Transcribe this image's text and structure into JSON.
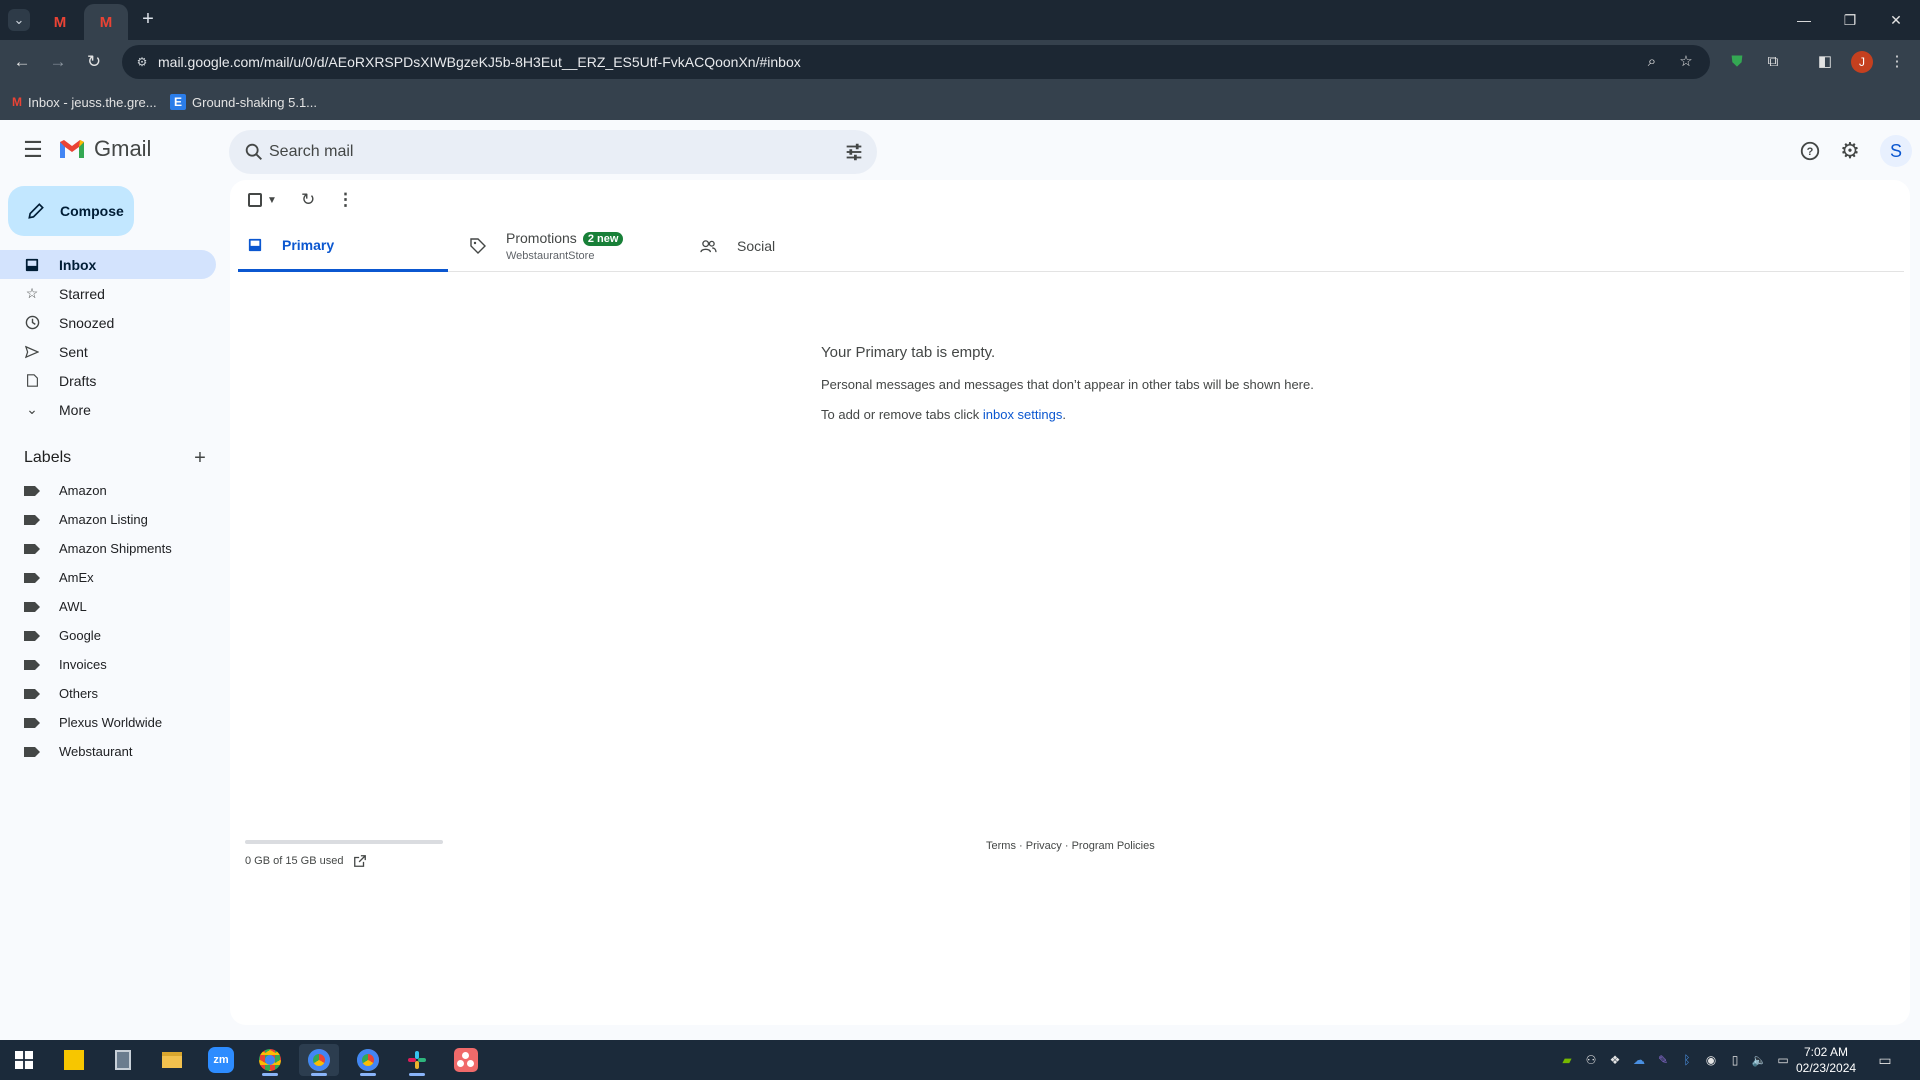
{
  "browser": {
    "tabs": [
      {
        "title": "Inbox - jeuss.the.gre...",
        "active": false
      },
      {
        "title": "Inbox - jeuss.the.gre...",
        "active": true
      }
    ],
    "url": "mail.google.com/mail/u/0/d/AEoRXRSPDsXIWBgzeKJ5b-8H3Eut__ERZ_ES5Utf-FvkACQoonXn/#inbox",
    "profile_initial": "J",
    "bookmarks": [
      {
        "label": "Inbox - jeuss.the.gre...",
        "icon": "gmail-icon"
      },
      {
        "label": "Ground-shaking 5.1...",
        "icon": "e-site-icon"
      }
    ]
  },
  "gmail": {
    "brand": "Gmail",
    "search_placeholder": "Search mail",
    "avatar_initial": "S",
    "compose_label": "Compose",
    "nav": [
      {
        "label": "Inbox",
        "icon": "inbox-icon",
        "active": true
      },
      {
        "label": "Starred",
        "icon": "star-icon",
        "active": false
      },
      {
        "label": "Snoozed",
        "icon": "clock-icon",
        "active": false
      },
      {
        "label": "Sent",
        "icon": "send-icon",
        "active": false
      },
      {
        "label": "Drafts",
        "icon": "draft-icon",
        "active": false
      },
      {
        "label": "More",
        "icon": "chevron-down-icon",
        "active": false
      }
    ],
    "labels_title": "Labels",
    "labels": [
      "Amazon",
      "Amazon Listing",
      "Amazon Shipments",
      "AmEx",
      "AWL",
      "Google",
      "Invoices",
      "Others",
      "Plexus Worldwide",
      "Webstaurant"
    ],
    "inbox_tabs": {
      "primary": "Primary",
      "promotions": "Promotions",
      "promotions_badge": "2 new",
      "promotions_sub": "WebstaurantStore",
      "social": "Social"
    },
    "empty_state": {
      "title": "Your Primary tab is empty.",
      "line1": "Personal messages and messages that don’t appear in other tabs will be shown here.",
      "line2_prefix": "To add or remove tabs click ",
      "line2_link": "inbox settings",
      "line2_suffix": "."
    },
    "storage": {
      "text": "0 GB of 15 GB used",
      "fraction_used": 0
    },
    "footer": {
      "terms": "Terms",
      "privacy": "Privacy",
      "policies": "Program Policies",
      "sep": " · "
    }
  },
  "taskbar": {
    "time": "7:02 AM",
    "date": "02/23/2024"
  },
  "colors": {
    "accent": "#0b57d0",
    "compose_bg": "#c2e7ff",
    "active_nav_bg": "#d3e3fd",
    "promo_badge": "#188038"
  }
}
